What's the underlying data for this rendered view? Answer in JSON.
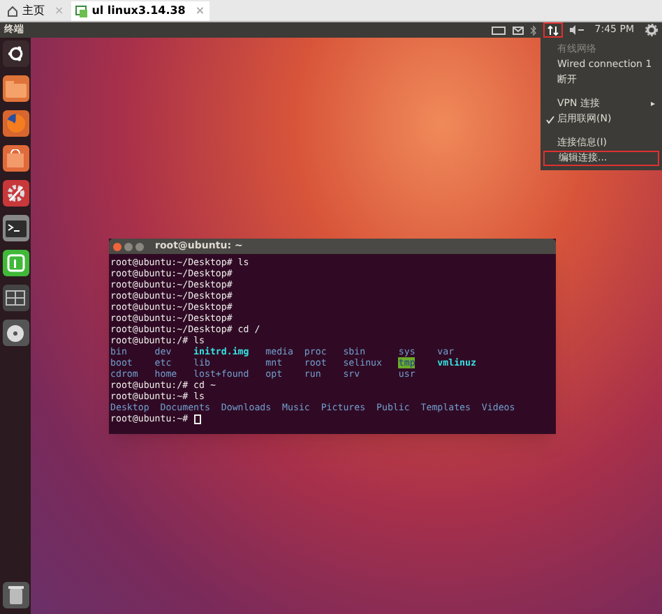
{
  "browser_tabs": [
    {
      "label": "主页",
      "close": "×",
      "selected": false
    },
    {
      "label": "ul linux3.14.38",
      "close": "×",
      "selected": true
    }
  ],
  "top_panel": {
    "app_name": "终端",
    "clock": "7:45 PM",
    "network_highlighted": true
  },
  "network_menu": {
    "items": [
      {
        "label": "有线网络",
        "kind": "header",
        "disabled": true,
        "checked": false,
        "highlighted": false
      },
      {
        "label": "Wired connection 1",
        "kind": "item",
        "disabled": false,
        "checked": false,
        "highlighted": false
      },
      {
        "label": "断开",
        "kind": "item",
        "disabled": false,
        "checked": false,
        "highlighted": false
      },
      {
        "label": "VPN 连接",
        "kind": "submenu",
        "arrow": "▸",
        "disabled": false,
        "checked": false,
        "highlighted": false
      },
      {
        "label": "启用联网(N)",
        "kind": "item",
        "disabled": false,
        "checked": true,
        "highlighted": false
      },
      {
        "label": "连接信息(I)",
        "kind": "item",
        "disabled": false,
        "checked": false,
        "highlighted": false
      },
      {
        "label": "编辑连接...",
        "kind": "item",
        "disabled": false,
        "checked": false,
        "highlighted": true
      }
    ]
  },
  "terminal": {
    "title": "root@ubuntu: ~",
    "lines": [
      {
        "kind": "prompt",
        "text": "root@ubuntu:~/Desktop# ls"
      },
      {
        "kind": "prompt",
        "text": "root@ubuntu:~/Desktop#"
      },
      {
        "kind": "prompt",
        "text": "root@ubuntu:~/Desktop#"
      },
      {
        "kind": "prompt",
        "text": "root@ubuntu:~/Desktop#"
      },
      {
        "kind": "prompt",
        "text": "root@ubuntu:~/Desktop#"
      },
      {
        "kind": "prompt",
        "text": "root@ubuntu:~/Desktop#"
      },
      {
        "kind": "prompt",
        "text": "root@ubuntu:~/Desktop# cd /"
      },
      {
        "kind": "prompt",
        "text": "root@ubuntu:/# ls"
      },
      {
        "kind": "listing",
        "entries": [
          {
            "name": "bin",
            "kind": "dir"
          },
          {
            "name": "dev",
            "kind": "dir"
          },
          {
            "name": "initrd.img",
            "kind": "link"
          },
          {
            "name": "media",
            "kind": "dir"
          },
          {
            "name": "proc",
            "kind": "dir"
          },
          {
            "name": "sbin",
            "kind": "dir"
          },
          {
            "name": "sys",
            "kind": "dir"
          },
          {
            "name": "var",
            "kind": "dir"
          }
        ]
      },
      {
        "kind": "listing",
        "entries": [
          {
            "name": "boot",
            "kind": "dir"
          },
          {
            "name": "etc",
            "kind": "dir"
          },
          {
            "name": "lib",
            "kind": "dir"
          },
          {
            "name": "mnt",
            "kind": "dir"
          },
          {
            "name": "root",
            "kind": "dir"
          },
          {
            "name": "selinux",
            "kind": "dir"
          },
          {
            "name": "tmp",
            "kind": "sticky"
          },
          {
            "name": "vmlinuz",
            "kind": "link"
          }
        ]
      },
      {
        "kind": "listing",
        "entries": [
          {
            "name": "cdrom",
            "kind": "dir"
          },
          {
            "name": "home",
            "kind": "dir"
          },
          {
            "name": "lost+found",
            "kind": "dir"
          },
          {
            "name": "opt",
            "kind": "dir"
          },
          {
            "name": "run",
            "kind": "dir"
          },
          {
            "name": "srv",
            "kind": "dir"
          },
          {
            "name": "usr",
            "kind": "dir"
          }
        ]
      },
      {
        "kind": "prompt",
        "text": "root@ubuntu:/# cd ~"
      },
      {
        "kind": "prompt",
        "text": "root@ubuntu:~# ls"
      },
      {
        "kind": "listing",
        "wide": true,
        "entries": [
          {
            "name": "Desktop",
            "kind": "dir"
          },
          {
            "name": "Documents",
            "kind": "dir"
          },
          {
            "name": "Downloads",
            "kind": "dir"
          },
          {
            "name": "Music",
            "kind": "dir"
          },
          {
            "name": "Pictures",
            "kind": "dir"
          },
          {
            "name": "Public",
            "kind": "dir"
          },
          {
            "name": "Templates",
            "kind": "dir"
          },
          {
            "name": "Videos",
            "kind": "dir"
          }
        ]
      },
      {
        "kind": "prompt",
        "text": "root@ubuntu:~#",
        "cursor": true
      }
    ]
  }
}
